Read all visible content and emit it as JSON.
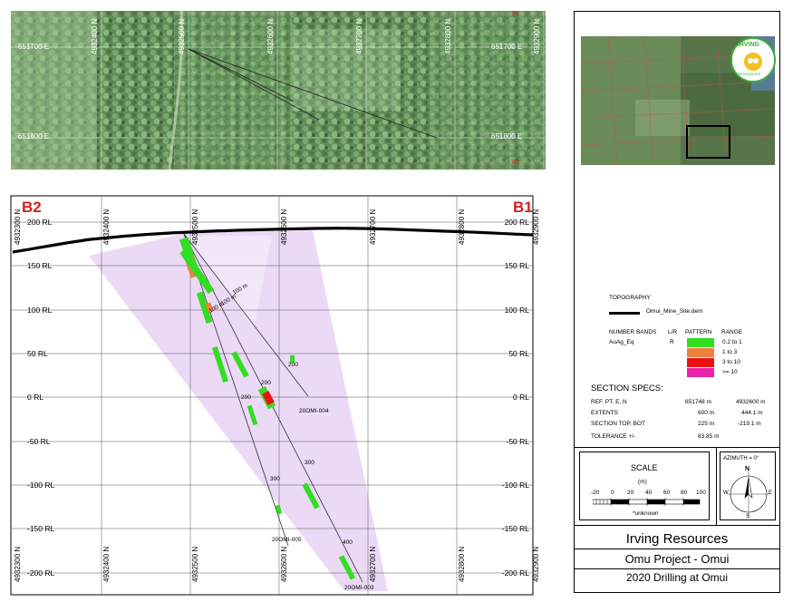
{
  "plan_view": {
    "easting_labels": [
      "651700 E",
      "651800 E"
    ],
    "northing_labels_top": [
      "4932400 N",
      "4932500 N",
      "4932600 N",
      "4932700 N",
      "4932800 N",
      "4932900 N"
    ],
    "top_right_label": "B1",
    "bottom_right_label": "B2"
  },
  "section": {
    "left_label": "B2",
    "right_label": "B1",
    "rl_labels": [
      "200 RL",
      "150 RL",
      "100 RL",
      "50 RL",
      "0 RL",
      "-50 RL",
      "-100 RL",
      "-150 RL",
      "-200 RL"
    ],
    "northing_labels": [
      "4932300 N",
      "4932400 N",
      "4932500 N",
      "4932600 N",
      "4932700 N",
      "4932800 N",
      "4932900 N"
    ],
    "holes": [
      {
        "name": "20OMI-003",
        "depth_labels": [
          "100 m",
          "200",
          "300",
          "400"
        ]
      },
      {
        "name": "20OMI-004",
        "depth_labels": [
          "100 m",
          "200"
        ]
      },
      {
        "name": "20OMI-005",
        "depth_labels": [
          "100 m",
          "200",
          "300"
        ]
      }
    ]
  },
  "legend": {
    "topography_title": "TOPOGRAPHY",
    "topography_item": "Omui_Mine_Site.dem",
    "bands_header": "NUMBER BANDS",
    "lr_header": "L/R",
    "pattern_header": "PATTERN",
    "range_header": "RANGE",
    "band_name": "AuAg_Eq",
    "band_side": "R",
    "ranges": [
      {
        "label": "0.2 to 1",
        "color": "#33dd22"
      },
      {
        "label": "1 to 3",
        "color": "#f08040"
      },
      {
        "label": "3 to 10",
        "color": "#ee1111"
      },
      {
        "label": ">= 10",
        "color": "#ee22aa"
      }
    ]
  },
  "specs": {
    "title": "SECTION  SPECS:",
    "rows": [
      {
        "label": "REF. PT.  E, N",
        "v1": "651748 m",
        "v2": "4932600 m"
      },
      {
        "label": "EXTENTS",
        "v1": "600 m",
        "v2": "444.1 m"
      },
      {
        "label": "SECTION TOP, BOT",
        "v1": "225 m",
        "v2": "-219.1 m"
      },
      {
        "label": "TOLERANCE  +/-",
        "v1": "83.85 m",
        "v2": ""
      }
    ]
  },
  "scale": {
    "title": "SCALE",
    "unit": "(m)",
    "ticks": [
      "-20",
      "0",
      "20",
      "40",
      "60",
      "80",
      "100"
    ],
    "note": "*unknown"
  },
  "azimuth": {
    "label": "AZIMUTH = 0°",
    "n": "N",
    "s": "S",
    "e": "E",
    "w": "W"
  },
  "title_block": {
    "company": "Irving Resources",
    "project": "Omu Project - Omui",
    "subtitle": "2020 Drilling at Omui"
  },
  "logo": {
    "text": "IRVING",
    "subtext": "RESOURCES"
  }
}
